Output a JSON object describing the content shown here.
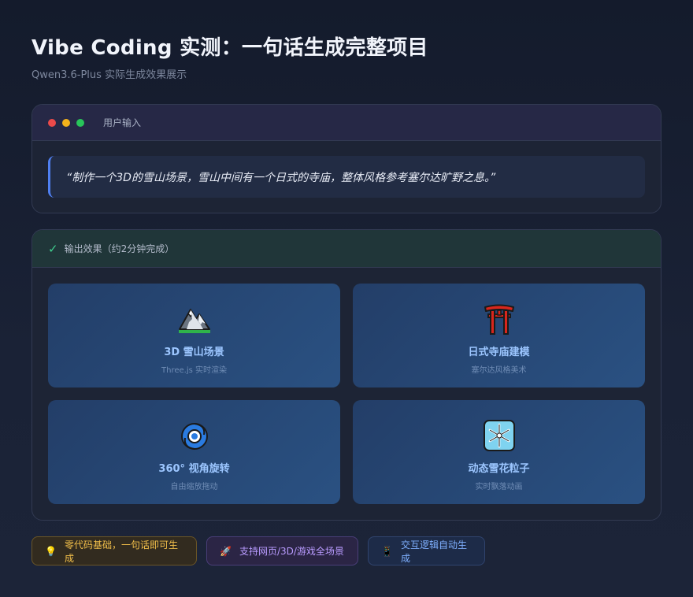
{
  "header": {
    "title": "Vibe Coding 实测：一句话生成完整项目",
    "subtitle": "Qwen3.6-Plus 实际生成效果展示"
  },
  "input_card": {
    "label": "用户输入",
    "prompt": "“制作一个3D的雪山场景，雪山中间有一个日式的寺庙，整体风格参考塞尔达旷野之息。”"
  },
  "output_card": {
    "label": "输出效果（约2分钟完成）",
    "tiles": [
      {
        "icon": "mountain-icon",
        "title": "3D 雪山场景",
        "subtitle": "Three.js 实时渲染"
      },
      {
        "icon": "torii-gate-icon",
        "title": "日式寺庙建模",
        "subtitle": "塞尔达风格美术"
      },
      {
        "icon": "cyclone-icon",
        "title": "360° 视角旋转",
        "subtitle": "自由缩放拖动"
      },
      {
        "icon": "snowflake-icon",
        "title": "动态雪花粒子",
        "subtitle": "实时飘落动画"
      }
    ]
  },
  "badges": [
    {
      "icon": "lightbulb-icon",
      "label": "零代码基础，一句话即可生成",
      "color": "#f2bf4a"
    },
    {
      "icon": "rocket-icon",
      "label": "支持网页/3D/游戏全场景",
      "color": "#b99bff"
    },
    {
      "icon": "phone-icon",
      "label": "交互逻辑自动生成",
      "color": "#7fb0ff"
    }
  ],
  "colors": {
    "accent_blue": "#4f7ff0",
    "check_green": "#3fcf8e"
  }
}
